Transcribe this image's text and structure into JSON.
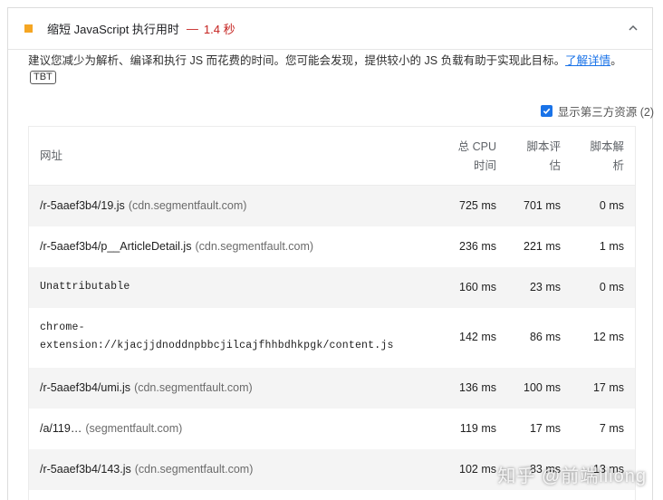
{
  "audit": {
    "title": "缩短 JavaScript 执行用时",
    "dash": "—",
    "value": "1.4 秒",
    "status_color": "#f5a623",
    "value_color": "#c5221f"
  },
  "description": {
    "text": "建议您减少为解析、编译和执行 JS 而花费的时间。您可能会发现，提供较小的 JS 负载有助于实现此目标。",
    "learn_more": "了解详情",
    "period": "。",
    "badge": "TBT"
  },
  "third_party": {
    "label": "显示第三方资源 (2)",
    "checked": true
  },
  "table": {
    "headers": {
      "url": "网址",
      "cpu_line1": "总 CPU",
      "cpu_line2": "时间",
      "eval_line1": "脚本评",
      "eval_line2": "估",
      "parse_line1": "脚本解",
      "parse_line2": "析"
    },
    "rows": [
      {
        "url": "/r-5aaef3b4/19.js",
        "host": "(cdn.segmentfault.com)",
        "cpu": "725 ms",
        "eval": "701 ms",
        "parse": "0 ms"
      },
      {
        "url": "/r-5aaef3b4/p__ArticleDetail.js",
        "host": "(cdn.segmentfault.com)",
        "cpu": "236 ms",
        "eval": "221 ms",
        "parse": "1 ms"
      },
      {
        "url": "Unattributable",
        "host": "",
        "cpu": "160 ms",
        "eval": "23 ms",
        "parse": "0 ms"
      },
      {
        "url_line1": "chrome-",
        "url_line2": "extension://kjacjjdnoddnpbbcjilcajfhhbdhkpgk/content.js",
        "cpu": "142 ms",
        "eval": "86 ms",
        "parse": "12 ms"
      },
      {
        "url": "/r-5aaef3b4/umi.js",
        "host": "(cdn.segmentfault.com)",
        "cpu": "136 ms",
        "eval": "100 ms",
        "parse": "17 ms"
      },
      {
        "url": "/a/119…",
        "host": "(segmentfault.com)",
        "cpu": "119 ms",
        "eval": "17 ms",
        "parse": "7 ms"
      },
      {
        "url": "/r-5aaef3b4/143.js",
        "host": "(cdn.segmentfault.com)",
        "cpu": "102 ms",
        "eval": "83 ms",
        "parse": "13 ms"
      }
    ]
  },
  "watermark": "知乎 @前端lilong"
}
